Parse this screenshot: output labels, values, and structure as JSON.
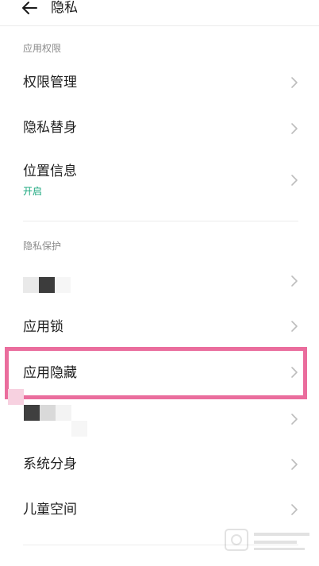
{
  "header": {
    "back_icon": "back-arrow-icon",
    "title": "隐私"
  },
  "sections": [
    {
      "title": "应用权限",
      "items": [
        {
          "label": "权限管理",
          "subtitle": ""
        },
        {
          "label": "隐私替身",
          "subtitle": ""
        },
        {
          "label": "位置信息",
          "subtitle": "开启"
        }
      ]
    },
    {
      "title": "隐私保护",
      "items": [
        {
          "label": "",
          "subtitle": ""
        },
        {
          "label": "应用锁",
          "subtitle": ""
        },
        {
          "label": "应用隐藏",
          "subtitle": ""
        },
        {
          "label": "",
          "subtitle": ""
        },
        {
          "label": "系统分身",
          "subtitle": ""
        },
        {
          "label": "儿童空间",
          "subtitle": ""
        }
      ]
    }
  ],
  "colors": {
    "accent_green": "#19a77d",
    "highlight_pink": "#ea6d9d"
  },
  "icons": {
    "row_chevron": "chevron-right-icon"
  }
}
